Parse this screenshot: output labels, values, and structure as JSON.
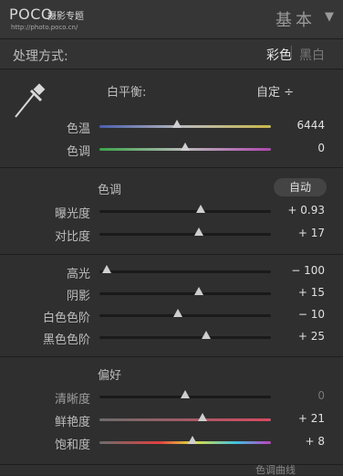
{
  "header": {
    "logo": "POCO",
    "logo_sub": "摄影专题",
    "logo_url": "http://photo.poco.cn/",
    "title": "基本",
    "collapse_icon": "triangle-down-icon"
  },
  "mode": {
    "label": "处理方式:",
    "color": "彩色",
    "separator": "|",
    "bw": "黑白"
  },
  "white_balance": {
    "label": "白平衡:",
    "value": "自定 ÷",
    "icon": "eyedropper-icon"
  },
  "wb_sliders": [
    {
      "label": "色温",
      "value": "6444",
      "position": 0.45,
      "track": "temp"
    },
    {
      "label": "色调",
      "value": "0",
      "position": 0.5,
      "track": "tint"
    }
  ],
  "tone": {
    "title": "色调",
    "auto_label": "自动"
  },
  "tone_sliders": [
    {
      "label": "曝光度",
      "value": "+ 0.93",
      "position": 0.59
    },
    {
      "label": "对比度",
      "value": "+ 17",
      "position": 0.58
    }
  ],
  "presence_sliders": [
    {
      "label": "高光",
      "value": "− 100",
      "position": 0.04
    },
    {
      "label": "阴影",
      "value": "+ 15",
      "position": 0.58
    },
    {
      "label": "白色色阶",
      "value": "− 10",
      "position": 0.46
    },
    {
      "label": "黑色色阶",
      "value": "+ 25",
      "position": 0.62
    }
  ],
  "presence": {
    "title": "偏好"
  },
  "pref_sliders": [
    {
      "label": "清晰度",
      "value": "0",
      "position": 0.5,
      "track": "plain",
      "dim": true
    },
    {
      "label": "鲜艳度",
      "value": "+ 21",
      "position": 0.6,
      "track": "vib"
    },
    {
      "label": "饱和度",
      "value": "+ 8",
      "position": 0.54,
      "track": "sat"
    }
  ],
  "footer": {
    "partial_text": "色调曲线"
  }
}
